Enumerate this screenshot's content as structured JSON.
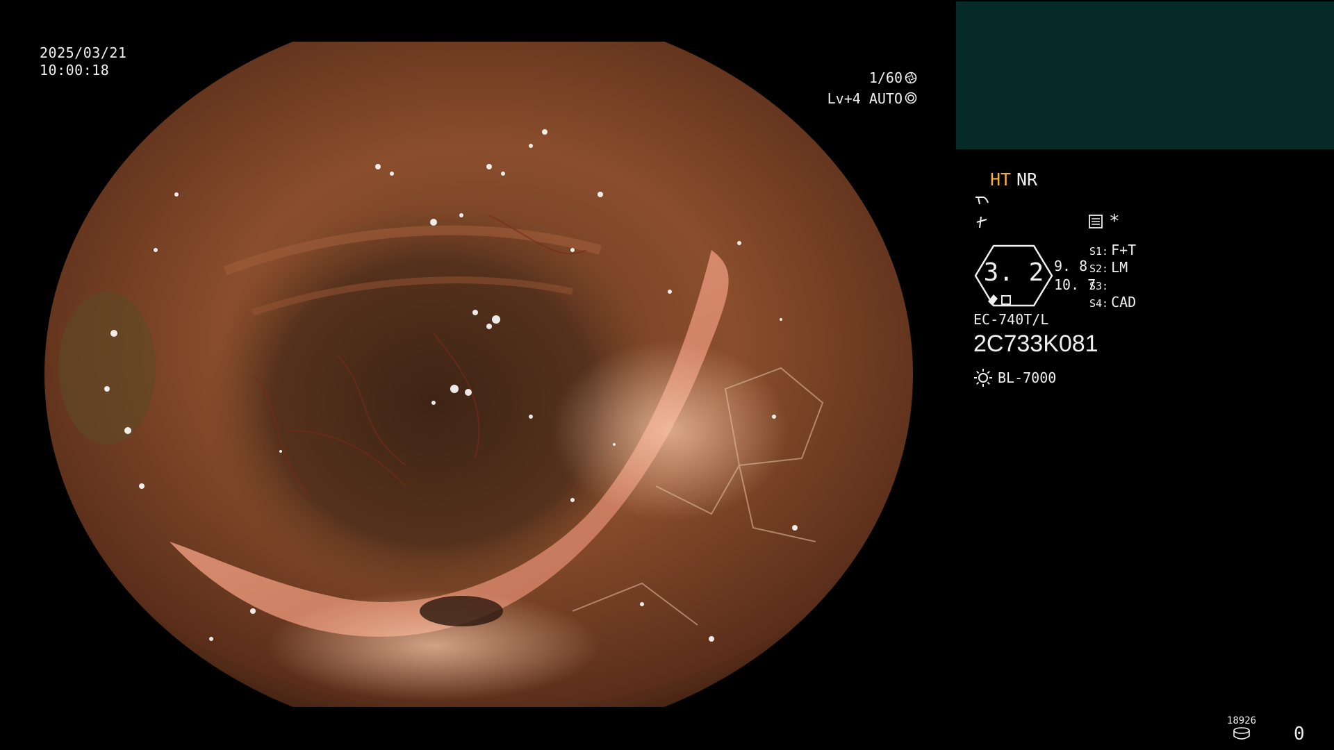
{
  "overlay": {
    "date": "2025/03/21",
    "time": "10:00:18",
    "shutter": "1/60",
    "level": "Lv+4",
    "mode": "AUTO"
  },
  "panel": {
    "ht": "HT",
    "nr": "NR",
    "zoom": "3. 2",
    "value_top": "9. 8",
    "value_bottom": "10. 7",
    "slots": [
      {
        "key": "S1:",
        "value": "F+T"
      },
      {
        "key": "S2:",
        "value": "LM"
      },
      {
        "key": "S3:",
        "value": ""
      },
      {
        "key": "S4:",
        "value": "CAD"
      }
    ],
    "asterisk": "*",
    "model": "EC-740T/L",
    "serial": "2C733K081",
    "light_source": "BL-7000"
  },
  "footer": {
    "counter": "18926",
    "index": "0"
  },
  "colors": {
    "background": "#000000",
    "thumbnail_panel": "#062a27",
    "ht_accent": "#f3b23b",
    "tissue_base": "#8a4e2c"
  },
  "icons": {
    "shutter": "shutter-aperture-icon",
    "auto": "auto-iris-icon",
    "a": "scope-function-icon",
    "b": "freeze-icon",
    "menu": "settings-list-icon",
    "light": "light-source-sun-icon",
    "storage": "storage-disk-icon"
  }
}
